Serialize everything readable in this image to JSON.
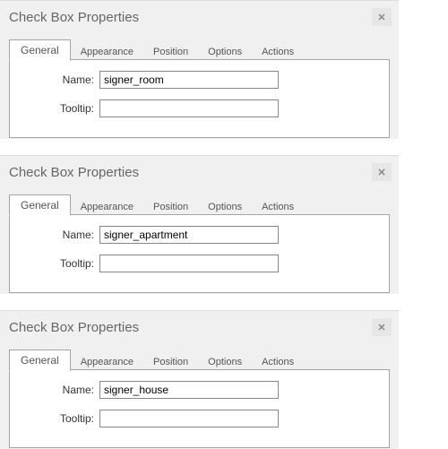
{
  "dialogs": [
    {
      "title": "Check Box Properties",
      "tabs": [
        "General",
        "Appearance",
        "Position",
        "Options",
        "Actions"
      ],
      "fields": {
        "name_label": "Name:",
        "name_value": "signer_room",
        "tooltip_label": "Tooltip:",
        "tooltip_value": ""
      }
    },
    {
      "title": "Check Box Properties",
      "tabs": [
        "General",
        "Appearance",
        "Position",
        "Options",
        "Actions"
      ],
      "fields": {
        "name_label": "Name:",
        "name_value": "signer_apartment",
        "tooltip_label": "Tooltip:",
        "tooltip_value": ""
      }
    },
    {
      "title": "Check Box Properties",
      "tabs": [
        "General",
        "Appearance",
        "Position",
        "Options",
        "Actions"
      ],
      "fields": {
        "name_label": "Name:",
        "name_value": "signer_house",
        "tooltip_label": "Tooltip:",
        "tooltip_value": ""
      }
    }
  ],
  "close_glyph": "✕"
}
